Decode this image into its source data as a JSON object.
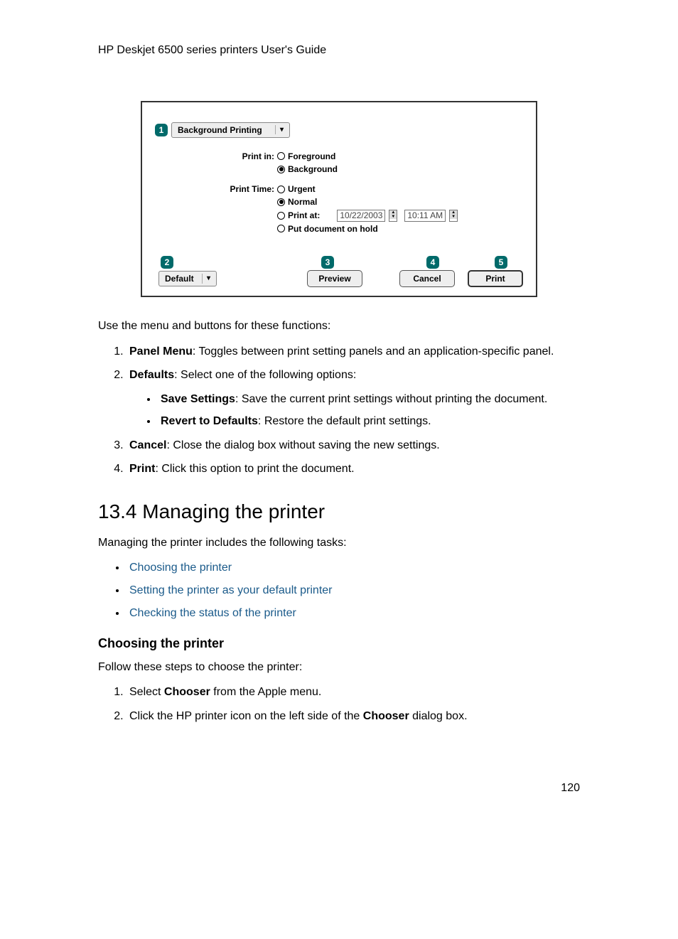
{
  "header": "HP Deskjet 6500 series printers User's Guide",
  "dialog": {
    "callout1": "1",
    "panel_menu_label": "Background Printing",
    "print_in_label": "Print in:",
    "print_in_opts": {
      "foreground": "Foreground",
      "background": "Background"
    },
    "print_time_label": "Print Time:",
    "print_time_opts": {
      "urgent": "Urgent",
      "normal": "Normal",
      "print_at": "Print at:",
      "hold": "Put document on hold"
    },
    "date_value": "10/22/2003",
    "time_value": "10:11 AM",
    "callout2": "2",
    "callout3": "3",
    "callout4": "4",
    "callout5": "5",
    "default_label": "Default",
    "preview_label": "Preview",
    "cancel_label": "Cancel",
    "print_label": "Print"
  },
  "body": {
    "intro": "Use the menu and buttons for these functions:",
    "item1_label": "Panel Menu",
    "item1_text": ": Toggles between print setting panels and an application-specific panel.",
    "item2_label": "Defaults",
    "item2_text": ": Select one of the following options:",
    "item2a_label": "Save Settings",
    "item2a_text": ": Save the current print settings without printing the document.",
    "item2b_label": "Revert to Defaults",
    "item2b_text": ": Restore the default print settings.",
    "item3_label": "Cancel",
    "item3_text": ": Close the dialog box without saving the new settings.",
    "item4_label": "Print",
    "item4_text": ": Click this option to print the document.",
    "section_title": "13.4  Managing the printer",
    "section_intro": "Managing the printer includes the following tasks:",
    "link1": "Choosing the printer",
    "link2": "Setting the printer as your default printer",
    "link3": "Checking the status of the printer",
    "sub_title": "Choosing the printer",
    "sub_intro": "Follow these steps to choose the printer:",
    "step1_pre": "Select ",
    "step1_bold": "Chooser",
    "step1_post": " from the Apple menu.",
    "step2_pre": "Click the HP printer icon on the left side of the ",
    "step2_bold": "Chooser",
    "step2_post": " dialog box."
  },
  "page_number": "120"
}
